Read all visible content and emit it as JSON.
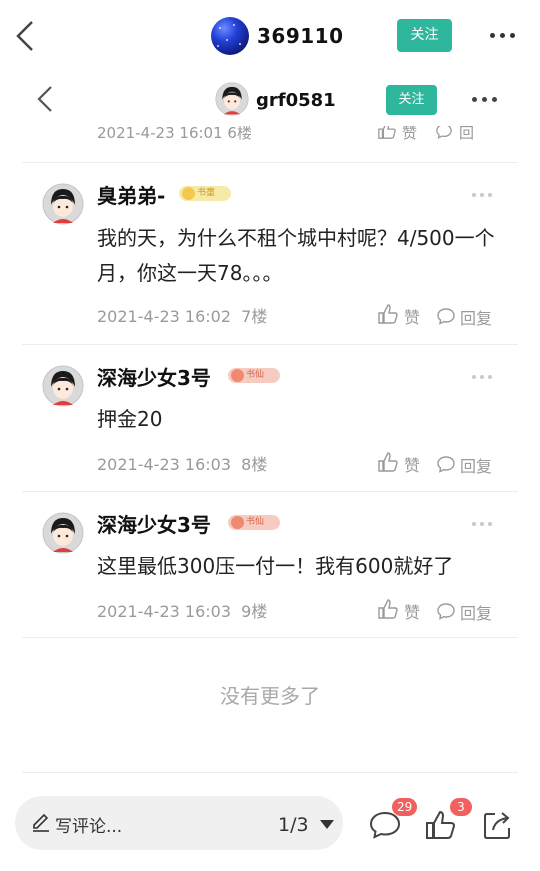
{
  "header": {
    "username": "369110",
    "follow_label": "关注"
  },
  "subheader": {
    "username": "grf0581",
    "follow_label": "关注"
  },
  "partial_row": {
    "meta": "2021-4-23 16:01  6楼",
    "like_label": "赞",
    "reply_label": "回复"
  },
  "comments": [
    {
      "name": "臭弟弟-",
      "badge": "书童",
      "text": "我的天，为什么不租个城中村呢？4/500一个月，你这一天78。。。",
      "time": "2021-4-23 16:02",
      "floor": "7楼",
      "like_label": "赞",
      "reply_label": "回复"
    },
    {
      "name": "深海少女3号",
      "badge": "书仙",
      "text": "押金20",
      "time": "2021-4-23 16:03",
      "floor": "8楼",
      "like_label": "赞",
      "reply_label": "回复"
    },
    {
      "name": "深海少女3号",
      "badge": "书仙",
      "text": "这里最低300压一付一！我有600就好了",
      "time": "2021-4-23 16:03",
      "floor": "9楼",
      "like_label": "赞",
      "reply_label": "回复"
    }
  ],
  "footer": {
    "no_more": "没有更多了"
  },
  "bottombar": {
    "placeholder": "写评论...",
    "page_indicator": "1/3",
    "comment_count": "29",
    "like_count": "3"
  },
  "colors": {
    "accent": "#2fb79d",
    "badge_red": "#f15f5f",
    "meta_gray": "#9a9a9a"
  },
  "icons": [
    "back-arrow-icon",
    "more-icon",
    "thumbs-up-icon",
    "reply-bubble-icon",
    "pen-icon",
    "comment-icon",
    "share-icon",
    "dropdown-caret-icon"
  ]
}
